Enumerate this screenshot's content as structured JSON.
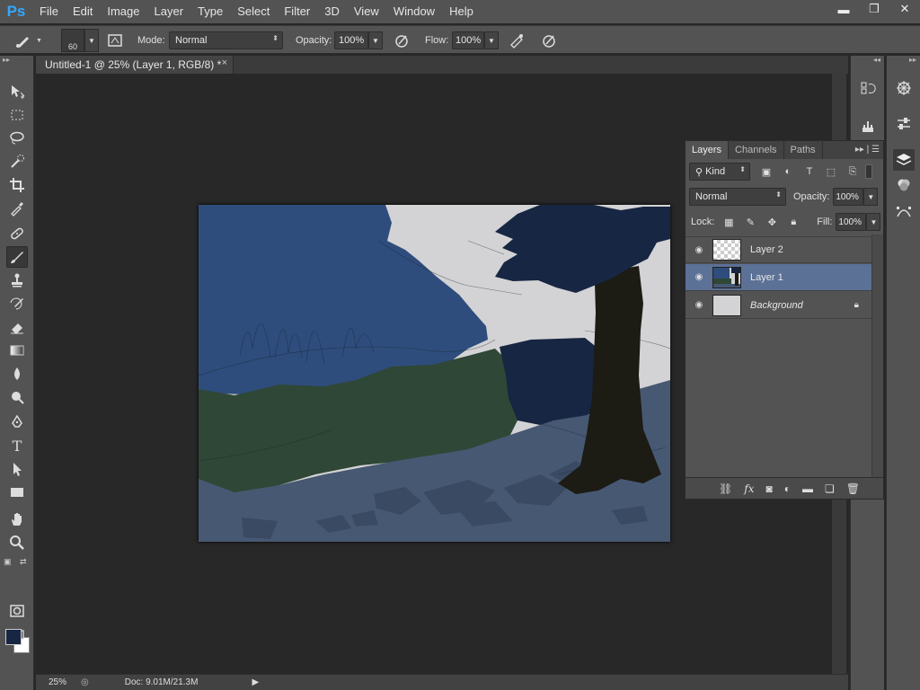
{
  "app": {
    "logo": "Ps"
  },
  "menu": [
    "File",
    "Edit",
    "Image",
    "Layer",
    "Type",
    "Select",
    "Filter",
    "3D",
    "View",
    "Window",
    "Help"
  ],
  "window_controls": {
    "minimize": "▬",
    "restore": "❐",
    "close": "✕"
  },
  "options_bar": {
    "brush_size": "60",
    "mode_label": "Mode:",
    "mode_value": "Normal",
    "opacity_label": "Opacity:",
    "opacity_value": "100%",
    "flow_label": "Flow:",
    "flow_value": "100%"
  },
  "document": {
    "tab_title": "Untitled-1 @ 25% (Layer 1, RGB/8) *",
    "close": "×"
  },
  "tools": [
    "move-tool",
    "marquee-tool",
    "lasso-tool",
    "quick-selection-tool",
    "crop-tool",
    "eyedropper-tool",
    "healing-brush-tool",
    "brush-tool",
    "clone-stamp-tool",
    "history-brush-tool",
    "eraser-tool",
    "gradient-tool",
    "blur-tool",
    "dodge-tool",
    "pen-tool",
    "type-tool",
    "path-selection-tool",
    "rectangle-tool",
    "hand-tool",
    "zoom-tool"
  ],
  "colors": {
    "foreground": "#172642",
    "background": "#ffffff",
    "selected_layer": "#5c7196",
    "ps_blue": "#31a8ff"
  },
  "status": {
    "zoom": "25%",
    "doc_size": "Doc: 9.01M/21.3M"
  },
  "layers_panel": {
    "tabs": [
      "Layers",
      "Channels",
      "Paths"
    ],
    "kind_label": "Kind",
    "blend_mode": "Normal",
    "opacity_label": "Opacity:",
    "opacity_value": "100%",
    "lock_label": "Lock:",
    "fill_label": "Fill:",
    "fill_value": "100%",
    "layers": [
      {
        "name": "Layer 2",
        "selected": false,
        "visible": true
      },
      {
        "name": "Layer 1",
        "selected": true,
        "visible": true
      },
      {
        "name": "Background",
        "selected": false,
        "visible": true,
        "locked": true
      }
    ],
    "footer_icons": [
      "link-icon",
      "fx-icon",
      "mask-icon",
      "adjustment-icon",
      "folder-icon",
      "new-layer-icon",
      "trash-icon"
    ]
  }
}
